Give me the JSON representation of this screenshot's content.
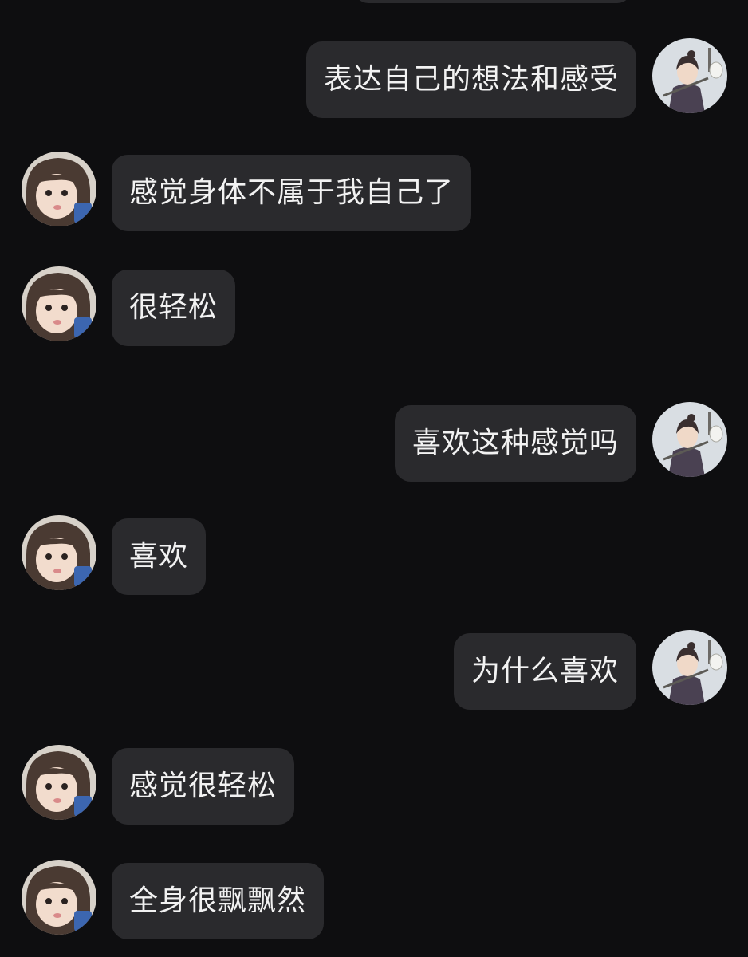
{
  "chat": {
    "messages": [
      {
        "side": "out",
        "avatar": "illustrated-man-avatar",
        "text": "表达自己的想法和感受"
      },
      {
        "side": "in",
        "avatar": "girl-photo-avatar",
        "text": "感觉身体不属于我自己了"
      },
      {
        "side": "in",
        "avatar": "girl-photo-avatar",
        "text": "很轻松"
      },
      {
        "side": "out",
        "avatar": "illustrated-man-avatar",
        "text": "喜欢这种感觉吗"
      },
      {
        "side": "in",
        "avatar": "girl-photo-avatar",
        "text": "喜欢"
      },
      {
        "side": "out",
        "avatar": "illustrated-man-avatar",
        "text": "为什么喜欢"
      },
      {
        "side": "in",
        "avatar": "girl-photo-avatar",
        "text": "感觉很轻松"
      },
      {
        "side": "in",
        "avatar": "girl-photo-avatar",
        "text": "全身很飘飘然"
      }
    ]
  },
  "colors": {
    "background": "#0e0e10",
    "bubble": "#2a2a2d",
    "text": "#f2f2f2"
  }
}
